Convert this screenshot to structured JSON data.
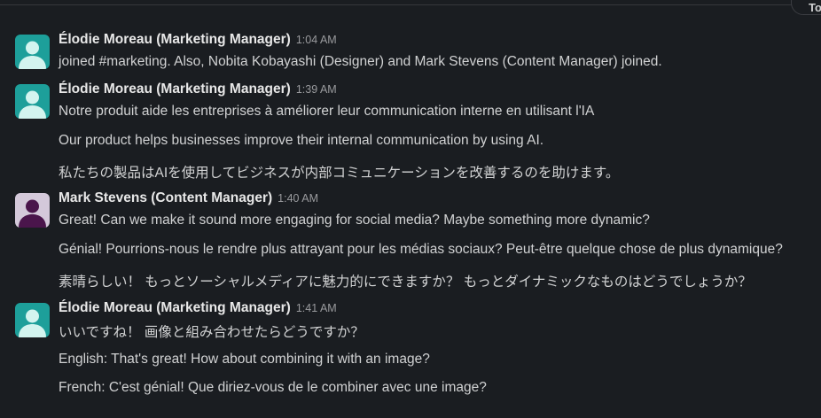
{
  "top_pill": {
    "label": "Today"
  },
  "messages": [
    {
      "author": "Élodie Moreau (Marketing Manager)",
      "time": "1:04 AM",
      "avatar": "user-avatar-teal",
      "lines": [
        "joined #marketing. Also, Nobita Kobayashi (Designer) and Mark Stevens (Content Manager) joined."
      ]
    },
    {
      "author": "Élodie Moreau (Marketing Manager)",
      "time": "1:39 AM",
      "avatar": "user-avatar-teal",
      "lines": [
        "Notre produit aide les entreprises à améliorer leur communication interne en utilisant l'IA",
        "Our product helps businesses improve their internal communication by using AI.",
        "私たちの製品はAIを使用してビジネスが内部コミュニケーションを改善するのを助けます。"
      ]
    },
    {
      "author": "Mark Stevens (Content Manager)",
      "time": "1:40 AM",
      "avatar": "user-avatar-purple",
      "lines": [
        "Great! Can we make it sound more engaging for social media? Maybe something more dynamic?",
        "Génial! Pourrions-nous le rendre plus attrayant pour les médias sociaux? Peut-être quelque chose de plus dynamique?",
        "素晴らしい！ もっとソーシャルメディアに魅力的にできますか？ もっとダイナミックなものはどうでしょうか？"
      ]
    },
    {
      "author": "Élodie Moreau (Marketing Manager)",
      "time": "1:41 AM",
      "avatar": "user-avatar-teal",
      "lines": [
        "いいですね！ 画像と組み合わせたらどうですか？",
        "English: That's great! How about combining it with an image?",
        "French: C'est génial! Que diriez-vous de le combiner avec une image?"
      ]
    }
  ],
  "colors": {
    "background": "#1a1d21",
    "teal_avatar_bg": "#1d9f9a",
    "teal_avatar_fg": "#d3f4ef",
    "purple_avatar_bg": "#d4c9da",
    "purple_avatar_fg": "#4a154b"
  }
}
